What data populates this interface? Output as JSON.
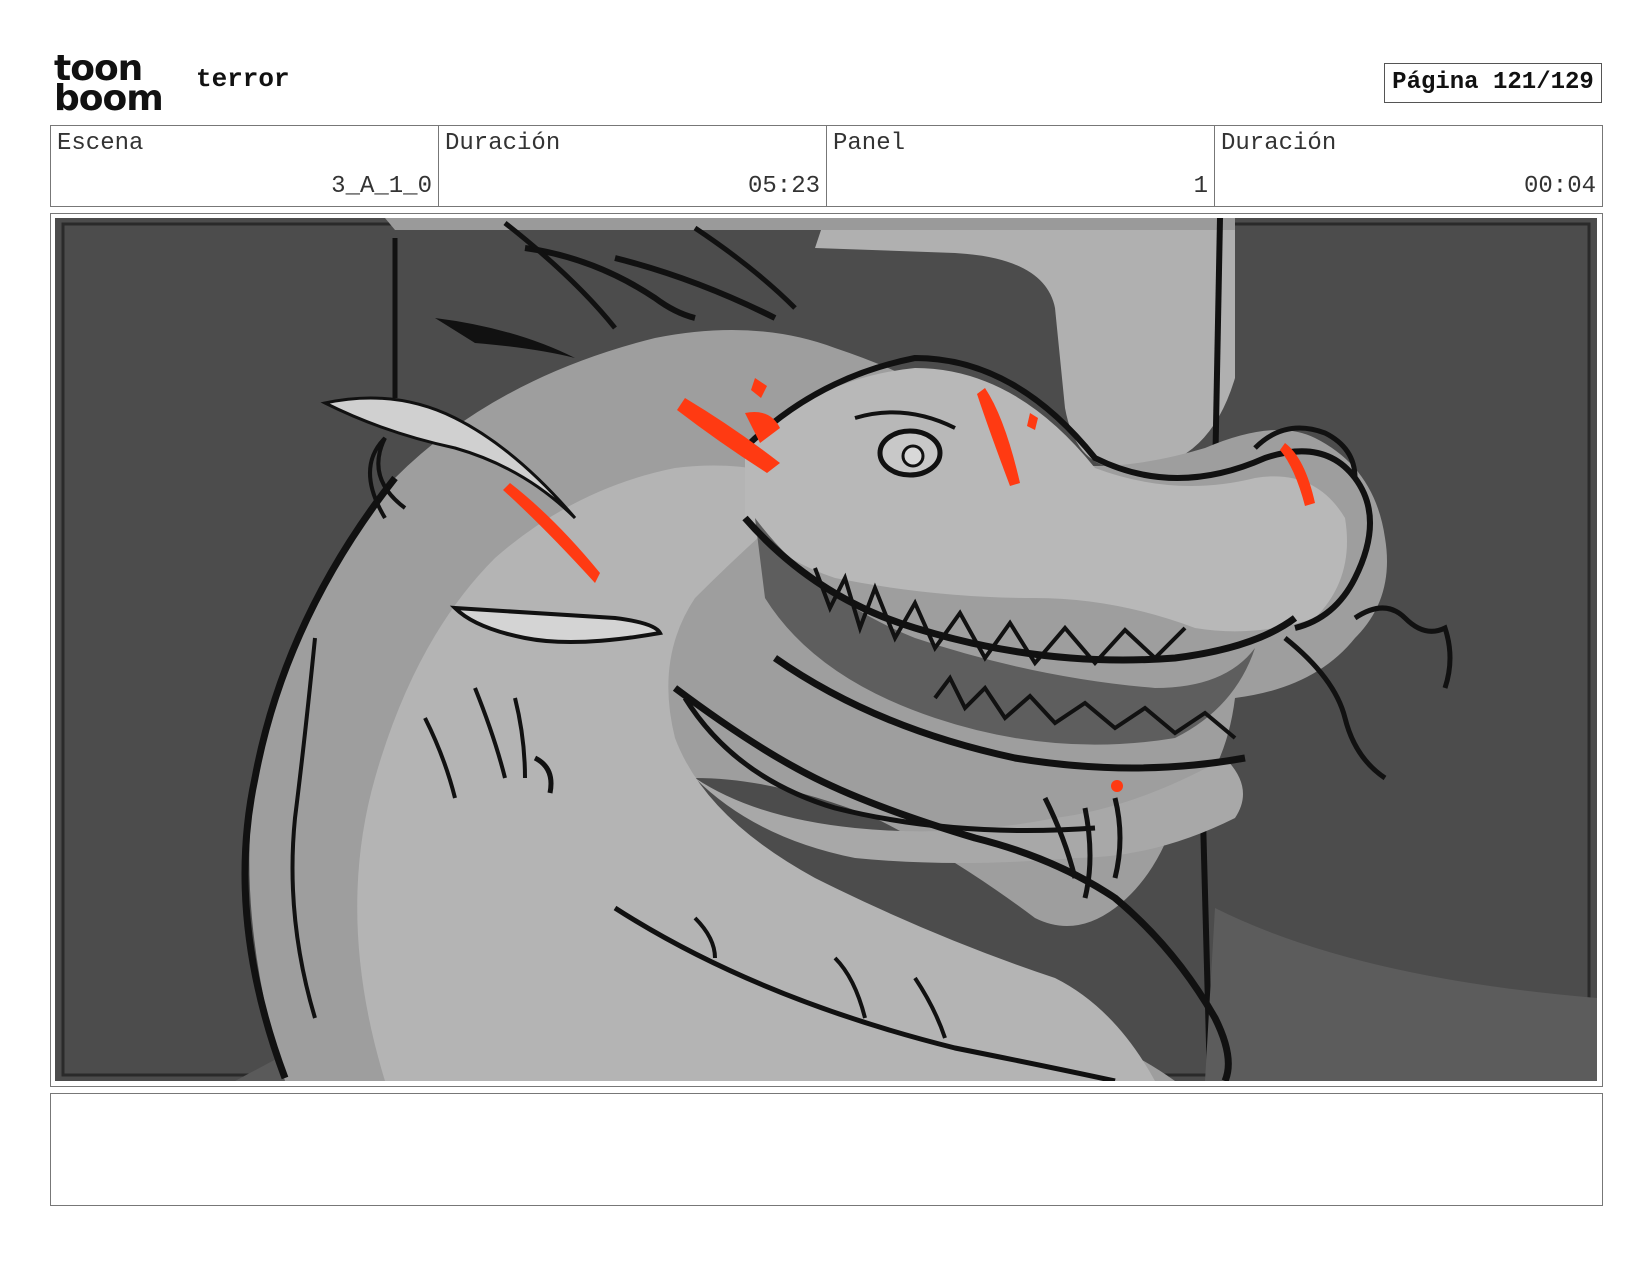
{
  "header": {
    "logo_line1": "toon",
    "logo_line2": "boom",
    "project_title": "terror",
    "page_label": "Página 121/129"
  },
  "info": {
    "scene_label": "Escena",
    "scene_value": "3_A_1_0",
    "scene_duration_label": "Duración",
    "scene_duration_value": "05:23",
    "panel_label": "Panel",
    "panel_value": "1",
    "panel_duration_label": "Duración",
    "panel_duration_value": "00:04"
  },
  "colors": {
    "accent_red": "#ff3a12",
    "dark_bg": "#4a4a4a",
    "mid_gray": "#8c8c8c",
    "light_gray": "#b3b3b3"
  },
  "panel": {
    "illustration": "dragon-head-sketch"
  },
  "notes": {
    "text": ""
  }
}
